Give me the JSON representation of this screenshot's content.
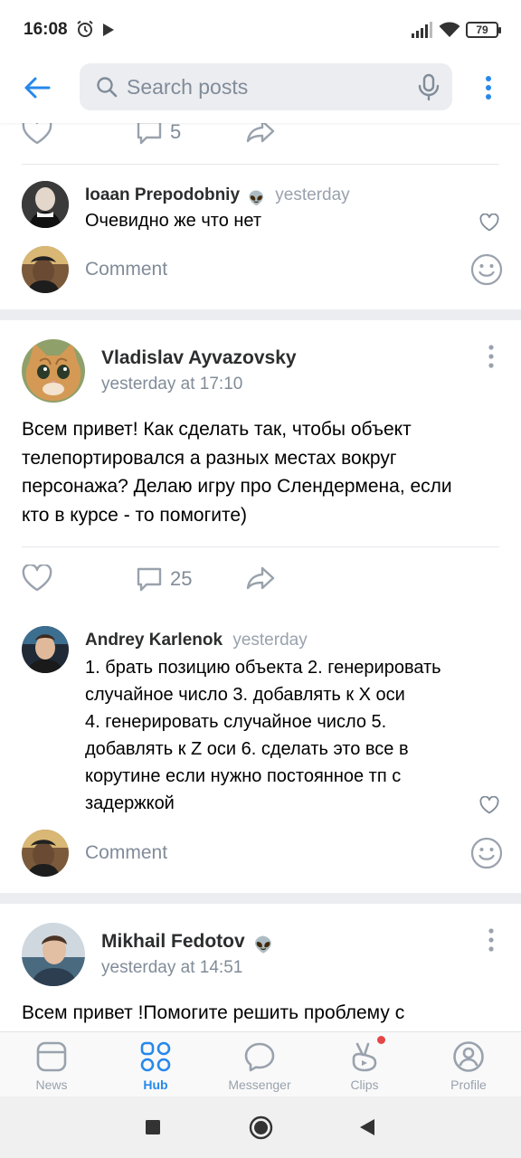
{
  "status_bar": {
    "time": "16:08",
    "battery": "79"
  },
  "header": {
    "search_placeholder": "Search posts"
  },
  "colors": {
    "accent": "#2688eb",
    "secondary": "#818c99",
    "badge": "#e64646"
  },
  "prev_post": {
    "comments_count": "5"
  },
  "prev_comment": {
    "author": "Ioaan Prepodobniy",
    "time": "yesterday",
    "text": "Очевидно же что нет",
    "author_emoji": "👽"
  },
  "comment_input_placeholder": "Comment",
  "post1": {
    "author": "Vladislav Ayvazovsky",
    "date": "yesterday at 17:10",
    "text_lines": [
      "Всем привет! Как сделать так, чтобы объект",
      "телепортировался а разных местах вокруг",
      "персонажа? Делаю игру про Слендермена, если",
      "кто в курсе - то помогите)"
    ],
    "comments_count": "25",
    "comment": {
      "author": "Andrey Karlenok",
      "time": "yesterday",
      "lines": [
        "1. брать позицию объекта 2. генерировать",
        "случайное число 3. добавлять к X оси",
        "4. генерировать случайное число  5.",
        "добавлять к Z оси 6. сделать это все в",
        "корутине если нужно постоянное тп с",
        "задержкой"
      ]
    }
  },
  "post2": {
    "author": "Mikhail Fedotov",
    "author_emoji": "👽",
    "date": "yesterday at 14:51",
    "text_lines": [
      "Всем привет !Помогите решить проблему с"
    ]
  },
  "tabs": [
    {
      "label": "News",
      "icon": "news-icon"
    },
    {
      "label": "Hub",
      "icon": "hub-icon",
      "active": true
    },
    {
      "label": "Messenger",
      "icon": "messenger-icon"
    },
    {
      "label": "Clips",
      "icon": "clips-icon",
      "badge": true
    },
    {
      "label": "Profile",
      "icon": "profile-icon"
    }
  ]
}
